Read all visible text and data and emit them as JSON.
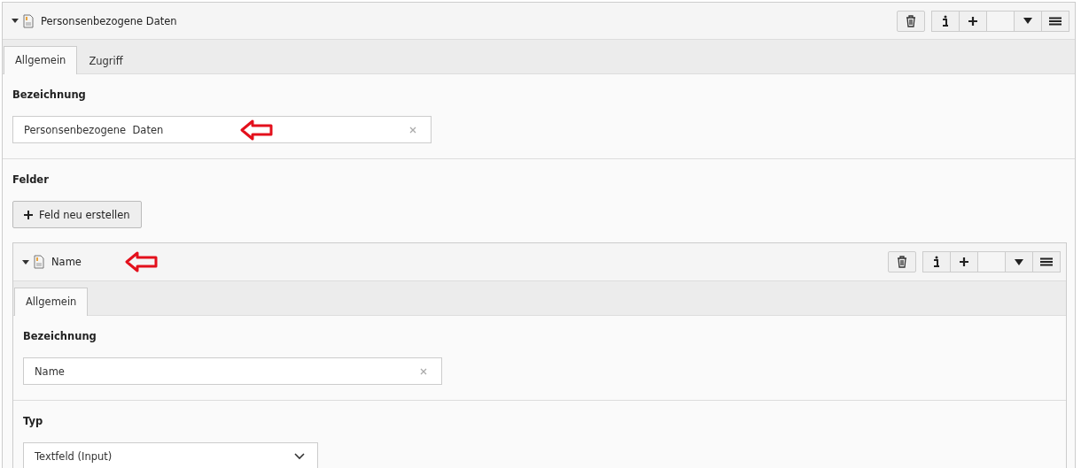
{
  "record": {
    "title": "Personsenbezogene Daten",
    "expanded": true,
    "tabs": [
      {
        "label": "Allgemein",
        "selected": true
      },
      {
        "label": "Zugriff",
        "selected": false
      }
    ],
    "name_label": "Bezeichnung",
    "name_value": "Personsenbezogene  Daten",
    "fields_label": "Felder",
    "new_field_button": "Feld neu erstellen",
    "field": {
      "title": "Name",
      "expanded": true,
      "tabs": [
        {
          "label": "Allgemein",
          "selected": true
        }
      ],
      "name_label": "Bezeichnung",
      "name_value": "Name",
      "type_label": "Typ",
      "type_value": "Textfeld (Input)"
    }
  }
}
